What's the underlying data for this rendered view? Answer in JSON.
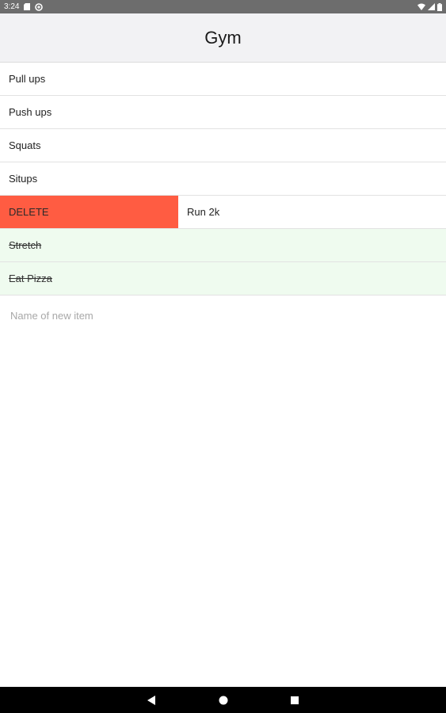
{
  "status_bar": {
    "time": "3:24",
    "icons": [
      "sd-card-icon",
      "data-saver-icon",
      "wifi-icon",
      "signal-icon",
      "battery-icon"
    ]
  },
  "header": {
    "title": "Gym"
  },
  "list": {
    "items": [
      {
        "label": "Pull ups",
        "completed": false
      },
      {
        "label": "Push ups",
        "completed": false
      },
      {
        "label": "Squats",
        "completed": false
      },
      {
        "label": "Situps",
        "completed": false
      },
      {
        "label": "Run 2k",
        "completed": false,
        "swiped": true,
        "action_label": "DELETE"
      },
      {
        "label": "Stretch",
        "completed": true
      },
      {
        "label": "Eat Pizza",
        "completed": true
      }
    ]
  },
  "new_item": {
    "placeholder": "Name of new item",
    "value": ""
  },
  "nav_bar": {
    "buttons": [
      "back-icon",
      "home-icon",
      "recents-icon"
    ]
  },
  "colors": {
    "status_bar": "#6d6d6d",
    "header_bg": "#f2f2f4",
    "delete_action": "#ff5c42",
    "completed_row": "#effbef",
    "nav_bar": "#000000"
  }
}
